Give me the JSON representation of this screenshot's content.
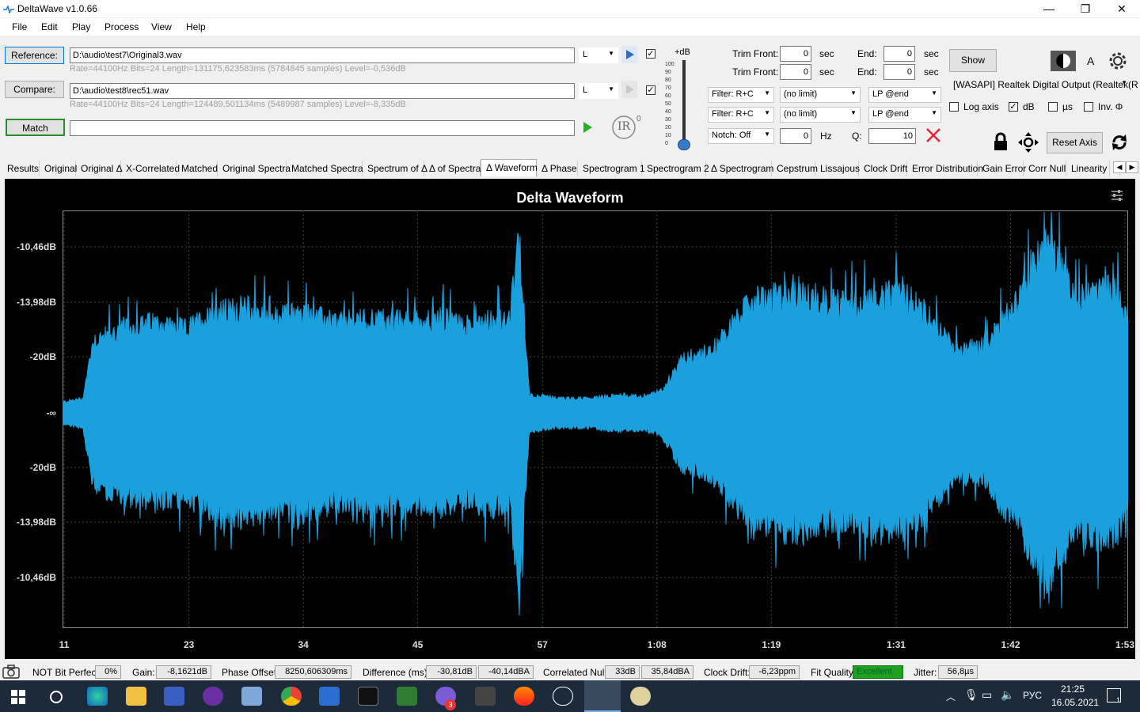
{
  "window": {
    "title": "DeltaWave v1.0.66"
  },
  "menu": [
    "File",
    "Edit",
    "Play",
    "Process",
    "View",
    "Help"
  ],
  "reference": {
    "button": "Reference:",
    "path": "D:\\audio\\test7\\Original3.wav",
    "channel": "L",
    "info": "Rate=44100Hz Bits=24 Length=131175,623583ms (5784845 samples) Level=-0,536dB"
  },
  "compare": {
    "button": "Compare:",
    "path": "D:\\audio\\test8\\rec51.wav",
    "channel": "L",
    "info": "Rate=44100Hz Bits=24 Length=124489,501134ms (5489987 samples) Level=-8,335dB"
  },
  "match": {
    "button": "Match",
    "value": ""
  },
  "ir_label": "IR",
  "ir_sup": "0",
  "db_slider": {
    "label": "+dB",
    "ticks": [
      "100",
      "90",
      "80",
      "70",
      "60",
      "50",
      "40",
      "30",
      "20",
      "10",
      "0"
    ],
    "value": 0
  },
  "trim": {
    "front_label": "Trim Front:",
    "end_label": "End:",
    "unit": "sec",
    "ref_front": "0",
    "ref_end": "0",
    "cmp_front": "0",
    "cmp_end": "0"
  },
  "filters": {
    "filter1": "Filter: R+C",
    "limit1": "(no limit)",
    "lp1": "LP @end",
    "filter2": "Filter: R+C",
    "limit2": "(no limit)",
    "lp2": "LP @end",
    "notch": "Notch: Off",
    "notch_hz": "0",
    "hz_label": "Hz",
    "q_label": "Q:",
    "q_value": "10"
  },
  "show_button": "Show",
  "a_label": "A",
  "output_device": "[WASAPI] Realtek Digital Output (Realtek(R",
  "options": {
    "log_axis": {
      "label": "Log axis",
      "checked": false
    },
    "db": {
      "label": "dB",
      "checked": true
    },
    "us": {
      "label": "µs",
      "checked": false
    },
    "inv": {
      "label": "Inv. Φ",
      "checked": false
    }
  },
  "reset_axis": "Reset Axis",
  "tabs": [
    "Results",
    "Original",
    "Original Δ",
    "X-Correlated",
    "Matched",
    "Original Spectra",
    "Matched Spectra",
    "Spectrum of Δ",
    "Δ of Spectra",
    "Δ Waveform",
    "Δ Phase",
    "Spectrogram 1",
    "Spectrogram 2",
    "Δ Spectrogram",
    "Cepstrum",
    "Lissajous",
    "Clock Drift",
    "Error Distribution",
    "Gain Error",
    "Corr Null",
    "Linearity",
    "I"
  ],
  "selected_tab": "Δ Waveform",
  "chart_data": {
    "type": "area",
    "title": "Delta Waveform",
    "yticks": [
      "-10,46dB",
      "-13,98dB",
      "-20dB",
      "-∞",
      "-20dB",
      "-13,98dB",
      "-10,46dB"
    ],
    "xticks": [
      "11",
      "23",
      "34",
      "45",
      "57",
      "1:08",
      "1:19",
      "1:31",
      "1:42",
      "1:53"
    ],
    "series": [
      {
        "color": "#1aa0dc",
        "x_seconds": [
          11,
          13,
          14,
          16,
          20,
          23,
          26,
          29,
          32,
          34,
          38,
          42,
          45,
          48,
          51,
          53,
          55,
          56,
          57,
          60,
          63,
          66,
          68,
          70,
          72,
          75,
          79,
          83,
          86,
          89,
          92,
          95,
          99,
          102,
          104,
          105,
          108,
          111,
          113,
          115,
          116
        ],
        "envelope": [
          0.06,
          0.08,
          0.4,
          0.44,
          0.5,
          0.46,
          0.55,
          0.58,
          0.52,
          0.55,
          0.5,
          0.52,
          0.5,
          0.52,
          0.48,
          0.52,
          0.5,
          0.95,
          0.1,
          0.08,
          0.08,
          0.1,
          0.09,
          0.12,
          0.3,
          0.35,
          0.62,
          0.65,
          0.62,
          0.6,
          0.65,
          0.62,
          0.35,
          0.38,
          0.55,
          0.6,
          0.95,
          0.62,
          0.7,
          0.65,
          0.5
        ]
      }
    ],
    "grid": true
  },
  "status": {
    "bit_perfect": "NOT Bit Perfect",
    "bit_perfect_pct": "0%",
    "gain_label": "Gain:",
    "gain": "-8,1621dB",
    "phase_label": "Phase Offset:",
    "phase": "8250,606309ms",
    "diff_label": "Difference (ms):",
    "diff_db": "-30,81dB",
    "diff_dba": "-40,14dBA",
    "null_label": "Correlated Null:",
    "null_db": "33dB",
    "null_dba": "35,84dBA",
    "drift_label": "Clock Drift:",
    "drift": "-6,23ppm",
    "fit_label": "Fit Quality:",
    "fit": "Excellent",
    "jitter_label": "Jitter:",
    "jitter": "56,8µs"
  },
  "taskbar": {
    "lang": "РУС",
    "time": "21:25",
    "date": "16.05.2021",
    "badge": "3",
    "notif": "1"
  }
}
